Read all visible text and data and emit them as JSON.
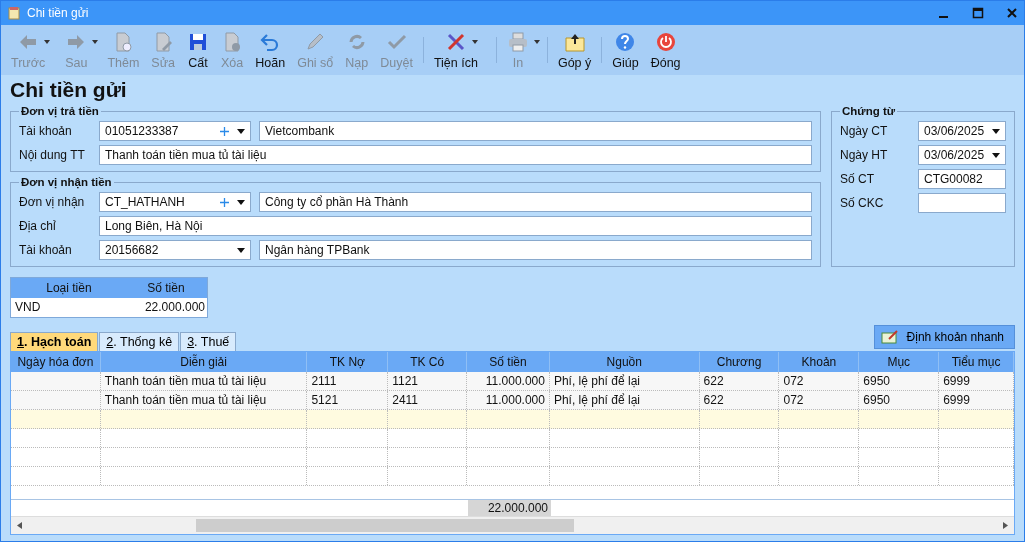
{
  "window": {
    "title": "Chi tiền gửi"
  },
  "toolbar": [
    {
      "label": "Trước",
      "disabled": true,
      "dropdown": true,
      "kind": "back",
      "separator": false
    },
    {
      "label": "Sau",
      "disabled": true,
      "dropdown": true,
      "kind": "forward",
      "separator": false
    },
    {
      "label": "Thêm",
      "disabled": true,
      "dropdown": false,
      "kind": "add",
      "separator": false
    },
    {
      "label": "Sửa",
      "disabled": true,
      "dropdown": false,
      "kind": "edit",
      "separator": false
    },
    {
      "label": "Cất",
      "disabled": false,
      "dropdown": false,
      "kind": "save",
      "separator": false
    },
    {
      "label": "Xóa",
      "disabled": true,
      "dropdown": false,
      "kind": "delete",
      "separator": false
    },
    {
      "label": "Hoãn",
      "disabled": false,
      "dropdown": false,
      "kind": "undo",
      "separator": false
    },
    {
      "label": "Ghi sổ",
      "disabled": true,
      "dropdown": false,
      "kind": "post",
      "separator": false
    },
    {
      "label": "Nạp",
      "disabled": true,
      "dropdown": false,
      "kind": "reload",
      "separator": false
    },
    {
      "label": "Duyệt",
      "disabled": true,
      "dropdown": false,
      "kind": "approve",
      "separator": true
    },
    {
      "label": "Tiện ích",
      "disabled": false,
      "dropdown": true,
      "kind": "tools",
      "separator": true
    },
    {
      "label": "In",
      "disabled": true,
      "dropdown": true,
      "kind": "print",
      "separator": true
    },
    {
      "label": "Góp ý",
      "disabled": false,
      "dropdown": false,
      "kind": "feedback",
      "separator": true
    },
    {
      "label": "Giúp",
      "disabled": false,
      "dropdown": false,
      "kind": "help",
      "separator": false
    },
    {
      "label": "Đóng",
      "disabled": false,
      "dropdown": false,
      "kind": "close",
      "separator": false
    }
  ],
  "heading": "Chi tiền gửi",
  "payer": {
    "title": "Đơn vị trả tiền",
    "rows": [
      {
        "label": "Tài khoản",
        "code": "01051233387",
        "add_button": true,
        "dropdown": true,
        "value": "Vietcombank"
      },
      {
        "label": "Nội dung TT",
        "value": "Thanh toán tiền mua tủ tài liệu"
      }
    ]
  },
  "payee": {
    "title": "Đơn vị nhận tiền",
    "rows": [
      {
        "label": "Đơn vị nhận",
        "code": "CT_HATHANH",
        "add_button": true,
        "dropdown": true,
        "value": "Công ty cổ phần Hà Thành"
      },
      {
        "label": "Địa chỉ",
        "value": "Long Biên, Hà Nội"
      },
      {
        "label": "Tài khoản",
        "code": "20156682",
        "add_button": false,
        "dropdown": true,
        "value": "Ngân hàng TPBank"
      }
    ]
  },
  "voucher": {
    "title": "Chứng từ",
    "rows": [
      {
        "label": "Ngày CT",
        "value": "03/06/2025",
        "dropdown": true
      },
      {
        "label": "Ngày HT",
        "value": "03/06/2025",
        "dropdown": true
      },
      {
        "label": "Số CT",
        "value": "CTG00082",
        "dropdown": false
      },
      {
        "label": "Số CKC",
        "dropdown": false
      }
    ]
  },
  "currency": {
    "columns": [
      "Loại tiền",
      "Số tiền"
    ],
    "row": [
      "VND",
      "22.000.000"
    ]
  },
  "tabs": [
    {
      "label": "1. Hạch toán",
      "selected": true
    },
    {
      "label": "2. Thống kê",
      "selected": false
    },
    {
      "label": "3. Thuế",
      "selected": false
    }
  ],
  "quick_button": "Định khoản nhanh",
  "grid": {
    "columns": [
      {
        "label": "Ngày hóa đơn"
      },
      {
        "label": "Diễn giải"
      },
      {
        "label": "TK Nợ"
      },
      {
        "label": "TK Có"
      },
      {
        "label": "Số tiền"
      },
      {
        "label": "Nguồn"
      },
      {
        "label": "Chương"
      },
      {
        "label": "Khoản"
      },
      {
        "label": "Mục"
      },
      {
        "label": "Tiểu mục"
      }
    ],
    "rows": [
      {
        "cells": [
          "",
          "Thanh toán tiền mua tủ tài liệu",
          "2111",
          "1121",
          "11.000.000",
          "Phí, lệ phí để lại",
          "622",
          "072",
          "6950",
          "6999"
        ]
      },
      {
        "cells": [
          "",
          "Thanh toán tiền mua tủ tài liệu",
          "5121",
          "2411",
          "11.000.000",
          "Phí, lệ phí để lại",
          "622",
          "072",
          "6950",
          "6999"
        ]
      }
    ],
    "total": "22.000.000"
  }
}
